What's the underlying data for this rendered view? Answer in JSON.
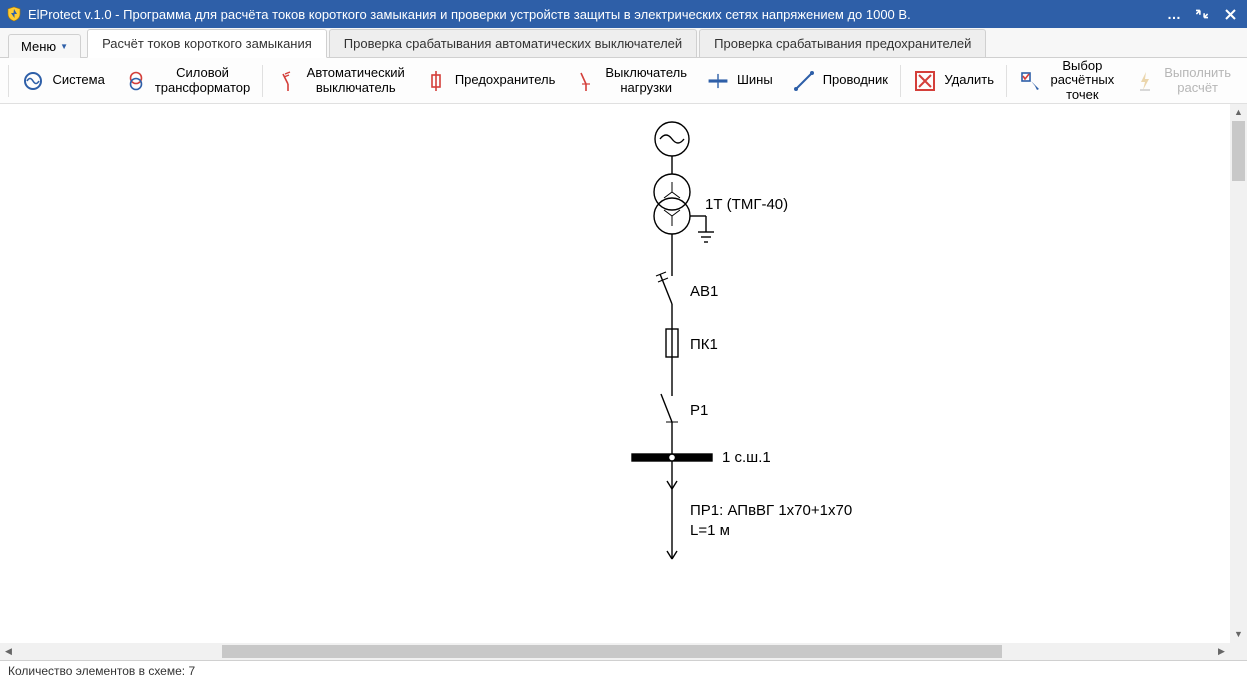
{
  "titlebar": {
    "text": "ElProtect v.1.0 - Программа для расчёта токов короткого замыкания и проверки устройств защиты в электрических сетях напряжением до 1000 В."
  },
  "menu": {
    "label": "Меню"
  },
  "tabs": [
    {
      "label": "Расчёт токов короткого замыкания",
      "active": true
    },
    {
      "label": "Проверка срабатывания автоматических выключателей",
      "active": false
    },
    {
      "label": "Проверка срабатывания предохранителей",
      "active": false
    }
  ],
  "toolbar": {
    "system": "Система",
    "transformer": "Силовой\nтрансформатор",
    "breaker": "Автоматический\nвыключатель",
    "fuse": "Предохранитель",
    "loadswitch": "Выключатель\nнагрузки",
    "bus": "Шины",
    "conductor": "Проводник",
    "delete": "Удалить",
    "points": "Выбор расчётных\nточек",
    "run": "Выполнить\nрасчёт"
  },
  "schematic": {
    "transformer_label": "1Т (ТМГ-40)",
    "breaker_label": "АВ1",
    "fuse_label": "ПК1",
    "switch_label": "Р1",
    "bus_label": "1 с.ш.1",
    "cable_line1": "ПР1: АПвВГ 1х70+1х70",
    "cable_line2": "L=1 м"
  },
  "status": {
    "text": "Количество элементов в схеме: 7"
  }
}
